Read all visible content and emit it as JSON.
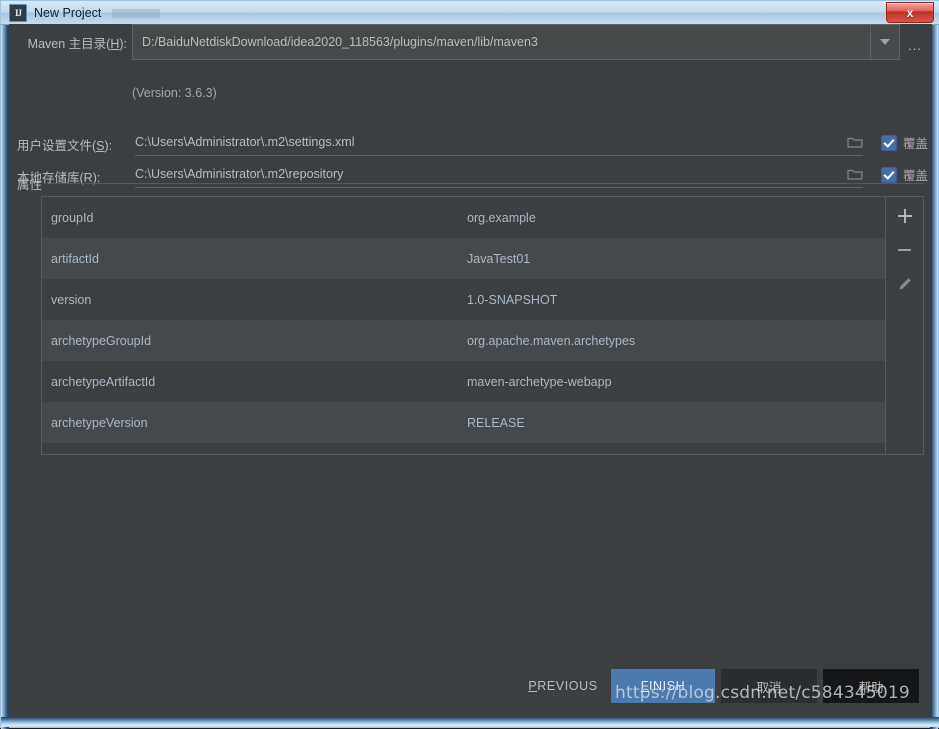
{
  "window": {
    "title": "New Project",
    "app_icon": "intellij-idea-icon",
    "close_label": "x"
  },
  "form": {
    "maven_home": {
      "label": "Maven 主目录(H):",
      "label_mnemonic": "H",
      "value": "D:/BaiduNetdiskDownload/idea2020_118563/plugins/maven/lib/maven3",
      "browse_label": "...",
      "version_note": "(Version: 3.6.3)"
    },
    "user_settings": {
      "label": "用户设置文件(S):",
      "label_mnemonic": "S",
      "value": "C:\\Users\\Administrator\\.m2\\settings.xml",
      "override_label": "覆盖",
      "override_checked": true
    },
    "local_repository": {
      "label": "本地存储库(R):",
      "label_mnemonic": "R",
      "value": "C:\\Users\\Administrator\\.m2\\repository",
      "override_label": "覆盖",
      "override_checked": true
    }
  },
  "properties": {
    "group_title": "属性",
    "rows": [
      {
        "key": "groupId",
        "value": "org.example"
      },
      {
        "key": "artifactId",
        "value": "JavaTest01"
      },
      {
        "key": "version",
        "value": "1.0-SNAPSHOT"
      },
      {
        "key": "archetypeGroupId",
        "value": "org.apache.maven.archetypes"
      },
      {
        "key": "archetypeArtifactId",
        "value": "maven-archetype-webapp"
      },
      {
        "key": "archetypeVersion",
        "value": "RELEASE"
      }
    ],
    "toolbar": {
      "add": "+",
      "remove": "−",
      "edit": "edit"
    }
  },
  "buttons": {
    "previous": "PREVIOUS",
    "previous_mnemonic": "P",
    "finish": "FINISH",
    "finish_mnemonic": "F",
    "cancel": "取消",
    "help": "帮助"
  },
  "watermark": "https://blog.csdn.net/c584345019",
  "colors": {
    "dialog_background": "#3c3f41",
    "row_alt_background": "#45494b",
    "text": "#bbbbbb",
    "table_text": "#a9b7c6",
    "accent_blue": "#4a7ab0",
    "checkbox_blue": "#4a6da7",
    "close_red": "#c12f28"
  }
}
